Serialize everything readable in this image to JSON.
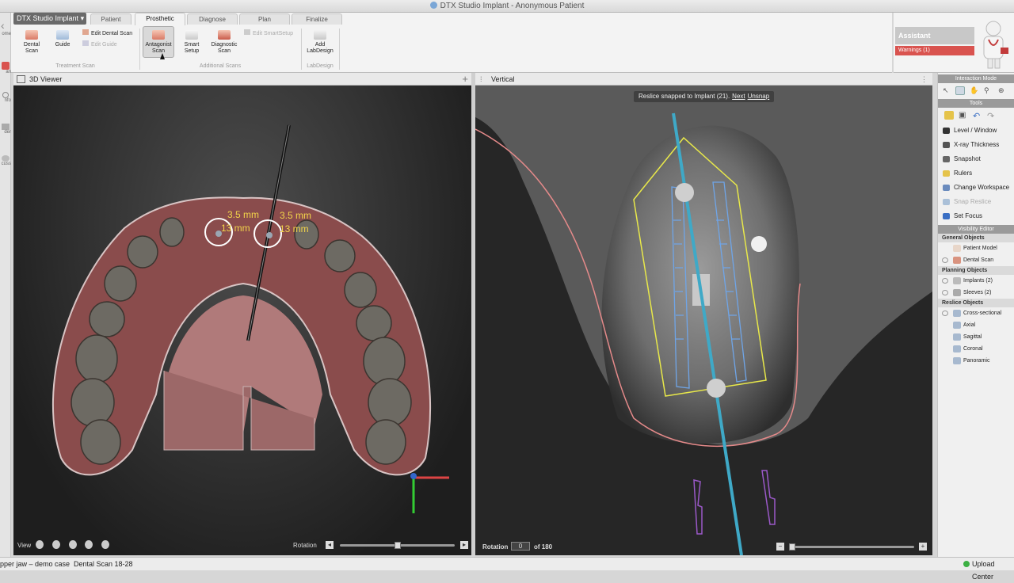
{
  "window": {
    "title": "DTX Studio Implant - Anonymous Patient"
  },
  "app_menu": {
    "label": "DTX Studio Implant"
  },
  "tabs": [
    {
      "label": "Patient"
    },
    {
      "label": "Prosthetic"
    },
    {
      "label": "Diagnose"
    },
    {
      "label": "Plan"
    },
    {
      "label": "Finalize"
    }
  ],
  "ribbon": {
    "dental_scan": "Dental Scan",
    "guide": "Guide",
    "edit_dental_scan": "Edit Dental Scan",
    "edit_guide": "Edit Guide",
    "group_treatment": "Treatment Scan",
    "antagonist_scan": "Antagonist Scan",
    "smart_setup": "Smart Setup",
    "diagnostic_scan": "Diagnostic Scan",
    "edit_smartsetup": "Edit SmartSetup",
    "group_additional": "Additional Scans",
    "add_labdesign": "Add LabDesign",
    "group_labdesign": "LabDesign"
  },
  "left_strip": [
    "ome",
    "an",
    "nfo",
    "der",
    "cuss"
  ],
  "assistant": {
    "title": "Assistant",
    "warnings": "Warnings (1)"
  },
  "viewer3d": {
    "title": "3D Viewer",
    "view_label": "View",
    "rotation_label": "Rotation",
    "slider_value": 0.5,
    "implant1": {
      "diameter": "3.5 mm",
      "length": "13 mm"
    },
    "implant2": {
      "diameter": "3.5 mm",
      "length": "13 mm"
    }
  },
  "vertical": {
    "title": "Vertical",
    "snap_text": "Reslice snapped to Implant (21).",
    "next": "Next",
    "unsnap": "Unsnap",
    "rotation_label": "Rotation",
    "rotation_value": "0",
    "rotation_of": "of 180",
    "slider_value": 0.0
  },
  "right_panel": {
    "interaction_mode": "Interaction Mode",
    "tools_title": "Tools",
    "tools": [
      {
        "label": "Level / Window",
        "enabled": true
      },
      {
        "label": "X-ray Thickness",
        "enabled": true
      },
      {
        "label": "Snapshot",
        "enabled": true
      },
      {
        "label": "Rulers",
        "enabled": true
      },
      {
        "label": "Change Workspace",
        "enabled": true
      },
      {
        "label": "Snap Reslice",
        "enabled": false
      },
      {
        "label": "Set Focus",
        "enabled": true
      }
    ],
    "visibility_title": "Visibility Editor",
    "general_objects": "General Objects",
    "patient_model": "Patient Model",
    "dental_scan": "Dental Scan",
    "planning_objects": "Planning Objects",
    "implants": "Implants (2)",
    "sleeves": "Sleeves (2)",
    "reslice_objects": "Reslice Objects",
    "reslice": [
      "Cross-sectional",
      "Axial",
      "Sagittal",
      "Coronal",
      "Panoramic"
    ]
  },
  "status": {
    "case": "pper jaw – demo case",
    "scan": "Dental Scan 18-28",
    "upload": "Upload Center"
  },
  "colors": {
    "warning": "#d9534f",
    "implant_label": "#f2d44a",
    "axis": "#3fa9c7"
  }
}
